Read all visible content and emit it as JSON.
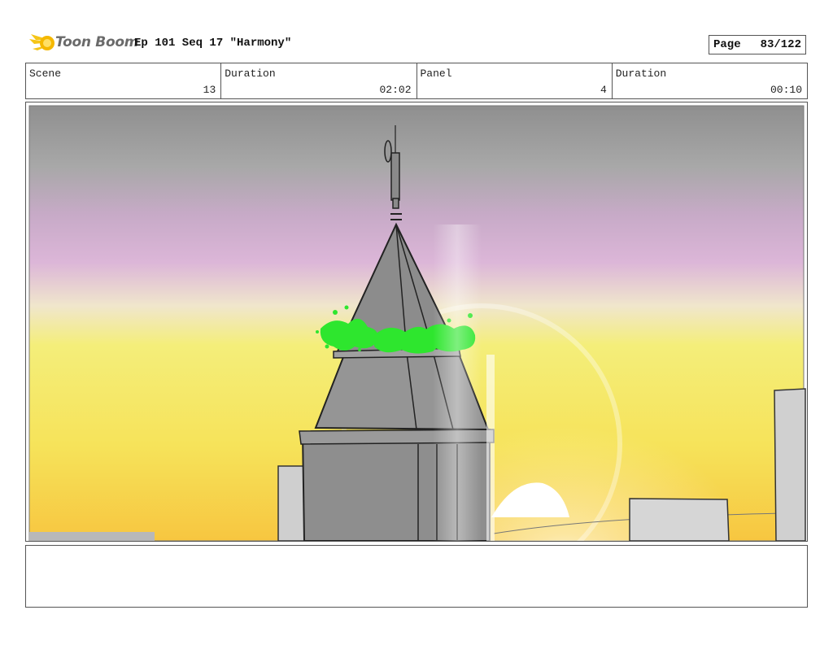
{
  "header": {
    "logo_text": "Toon Boom",
    "title": "Ep 101 Seq 17 \"Harmony\"",
    "page_label": "Page",
    "page_value": "83/122"
  },
  "info": {
    "scene_label": "Scene",
    "scene_value": "13",
    "duration_label": "Duration",
    "duration_value": "02:02",
    "panel_label": "Panel",
    "panel_value": "4",
    "panel_duration_label": "Duration",
    "panel_duration_value": "00:10"
  },
  "panel": {
    "description": "",
    "colors": {
      "sky_top": "#9e9e9e",
      "sky_pink": "#dcb6d8",
      "sky_yellow": "#f4ee7a",
      "sky_orange": "#f7c640",
      "building": "#8e8e8e",
      "foliage": "#2ee62e"
    }
  },
  "notes": {
    "text": ""
  }
}
